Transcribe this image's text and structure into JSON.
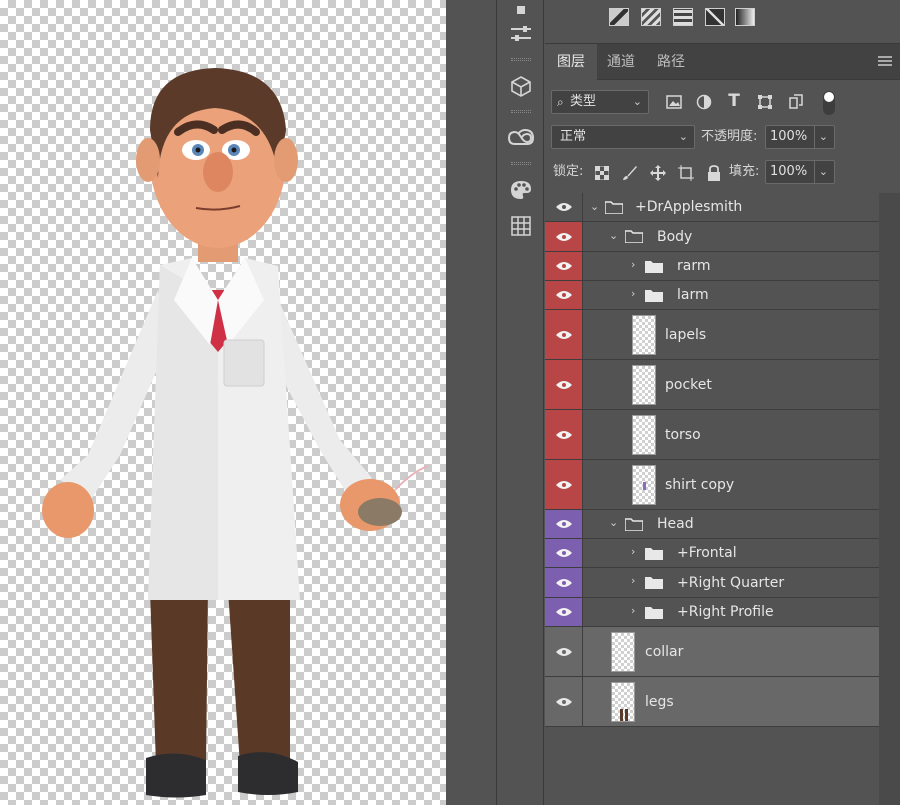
{
  "panel": {
    "tabs": [
      {
        "label": "图层"
      },
      {
        "label": "通道"
      },
      {
        "label": "路径"
      }
    ]
  },
  "filter": {
    "kind_label": "类型"
  },
  "blend": {
    "mode": "正常",
    "opacity_label": "不透明度:",
    "opacity_value": "100%"
  },
  "lock": {
    "label": "锁定:",
    "fill_label": "填充:",
    "fill_value": "100%"
  },
  "layers": [
    {
      "name": "+DrApplesmith",
      "type": "group",
      "expanded": true,
      "color": "none"
    },
    {
      "name": "Body",
      "type": "group",
      "expanded": true,
      "color": "red"
    },
    {
      "name": "rarm",
      "type": "group",
      "expanded": false,
      "color": "red"
    },
    {
      "name": "larm",
      "type": "group",
      "expanded": false,
      "color": "red"
    },
    {
      "name": "lapels",
      "type": "layer",
      "color": "red"
    },
    {
      "name": "pocket",
      "type": "layer",
      "color": "red"
    },
    {
      "name": "torso",
      "type": "layer",
      "color": "red"
    },
    {
      "name": "shirt copy",
      "type": "layer",
      "color": "red"
    },
    {
      "name": "Head",
      "type": "group",
      "expanded": true,
      "color": "purple"
    },
    {
      "name": "+Frontal",
      "type": "group",
      "expanded": false,
      "color": "purple"
    },
    {
      "name": "+Right Quarter",
      "type": "group",
      "expanded": false,
      "color": "purple"
    },
    {
      "name": "+Right Profile",
      "type": "group",
      "expanded": false,
      "color": "purple"
    },
    {
      "name": "collar",
      "type": "layer",
      "color": "none"
    },
    {
      "name": "legs",
      "type": "layer",
      "color": "none"
    }
  ],
  "colors": {
    "label_red": "#b84646",
    "label_purple": "#7c5fae",
    "panel_bg": "#535353",
    "selected_row": "#686868"
  }
}
